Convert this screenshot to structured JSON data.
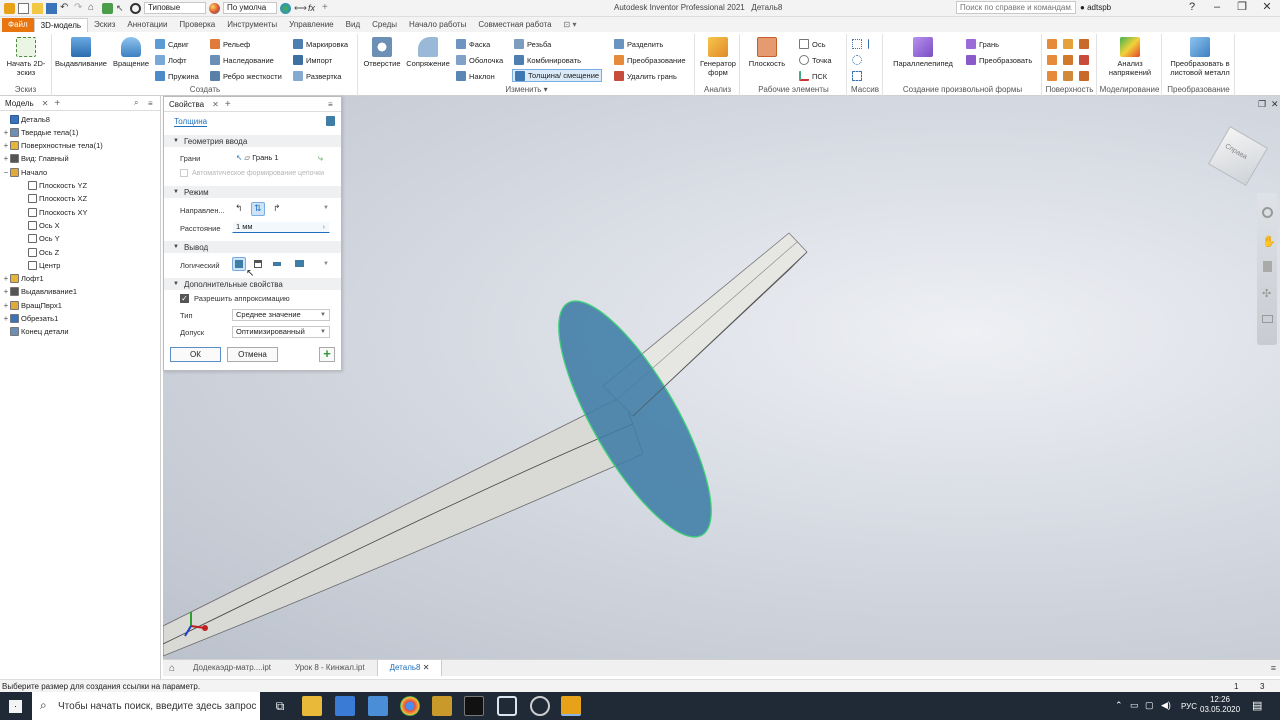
{
  "titlebar": {
    "app_title": "Autodesk Inventor Professional 2021",
    "doc_title": "Деталь8",
    "appearance_dropdown": "Типовые",
    "material_dropdown": "По умолча",
    "help_search_placeholder": "Поиск по справке и командам...",
    "user": "adtspb"
  },
  "tabs": [
    "Файл",
    "3D-модель",
    "Эскиз",
    "Аннотации",
    "Проверка",
    "Инструменты",
    "Управление",
    "Вид",
    "Среды",
    "Начало работы",
    "Совместная работа"
  ],
  "ribbon": {
    "sketch": {
      "start_sketch": "Начать 2D-эскиз",
      "label": "Эскиз"
    },
    "create": {
      "extrude": "Выдавливание",
      "revolve": "Вращение",
      "sweep": "Сдвиг",
      "loft": "Лофт",
      "coil": "Пружина",
      "emboss": "Рельеф",
      "derive": "Наследование",
      "rib": "Ребро жесткости",
      "decal": "Маркировка",
      "import": "Импорт",
      "unwrap": "Развертка",
      "label": "Создать"
    },
    "modify": {
      "hole": "Отверстие",
      "fillet": "Сопряжение",
      "chamfer": "Фаска",
      "shell": "Оболочка",
      "draft": "Наклон",
      "thread": "Резьба",
      "combine": "Комбинировать",
      "thicken": "Толщина/ смещение",
      "split": "Разделить",
      "direct": "Преобразование",
      "delete_face": "Удалить грань",
      "label": "Изменить"
    },
    "explore": {
      "generator": "Генератор форм",
      "label": "Анализ"
    },
    "work": {
      "plane": "Плоскость",
      "axis": "Ось",
      "point": "Точка",
      "ucs": "ПСК",
      "label": "Рабочие элементы"
    },
    "pattern": {
      "label": "Массив"
    },
    "freeform": {
      "box": "Параллелепипед",
      "face": "Грань",
      "convert": "Преобразовать",
      "label": "Создание произвольной формы"
    },
    "surface": {
      "label": "Поверхность"
    },
    "simulation": {
      "stress": "Анализ напряжений",
      "label": "Моделирование"
    },
    "convert": {
      "sheetmetal": "Преобразовать в листовой металл",
      "label": "Преобразование"
    }
  },
  "browser": {
    "tabs": [
      "Модель",
      "Свойства"
    ],
    "tree": [
      {
        "label": "Деталь8",
        "level": 0,
        "expander": ""
      },
      {
        "label": "Твердые тела(1)",
        "level": 1,
        "expander": "+"
      },
      {
        "label": "Поверхностные тела(1)",
        "level": 1,
        "expander": "+"
      },
      {
        "label": "Вид: Главный",
        "level": 1,
        "expander": "+"
      },
      {
        "label": "Начало",
        "level": 1,
        "expander": "−"
      },
      {
        "label": "Плоскость YZ",
        "level": 2,
        "expander": ""
      },
      {
        "label": "Плоскость XZ",
        "level": 2,
        "expander": ""
      },
      {
        "label": "Плоскость XY",
        "level": 2,
        "expander": ""
      },
      {
        "label": "Ось X",
        "level": 2,
        "expander": ""
      },
      {
        "label": "Ось Y",
        "level": 2,
        "expander": ""
      },
      {
        "label": "Ось Z",
        "level": 2,
        "expander": ""
      },
      {
        "label": "Центр",
        "level": 2,
        "expander": ""
      },
      {
        "label": "Лофт1",
        "level": 1,
        "expander": "+"
      },
      {
        "label": "Выдавливание1",
        "level": 1,
        "expander": "+"
      },
      {
        "label": "ВращПврх1",
        "level": 1,
        "expander": "+"
      },
      {
        "label": "Обрезать1",
        "level": 1,
        "expander": "+"
      },
      {
        "label": "Конец детали",
        "level": 1,
        "expander": ""
      }
    ]
  },
  "props": {
    "title": "Толщина",
    "input_geometry": {
      "header": "Геометрия ввода",
      "faces_label": "Грани",
      "faces_value": "Грань 1",
      "auto_chain": "Автоматическое формирование цепочки"
    },
    "mode": {
      "header": "Режим",
      "direction_label": "Направлен...",
      "distance_label": "Расстояние",
      "distance_value": "1 мм"
    },
    "output": {
      "header": "Вывод",
      "boolean_label": "Логический"
    },
    "advanced": {
      "header": "Дополнительные свойства",
      "allow_approx": "Разрешить аппроксимацию",
      "allow_approx_checked": true,
      "type_label": "Тип",
      "type_value": "Среднее значение",
      "tolerance_label": "Допуск",
      "tolerance_value": "Оптимизированный"
    },
    "ok": "ОК",
    "cancel": "Отмена"
  },
  "viewcube": {
    "face": "Справа"
  },
  "doc_tabs": [
    "Додекаэдр-матр....ipt",
    "Урок 8 - Кинжал.ipt",
    "Деталь8"
  ],
  "doc_tab_right": [
    "1",
    "3"
  ],
  "status": "Выберите размер для создания ссылки на параметр.",
  "taskbar": {
    "search_placeholder": "Чтобы начать поиск, введите здесь запрос",
    "lang": "РУС",
    "time": "12:26",
    "date": "03.05.2020"
  },
  "colors": {
    "accent": "#1e6fbf",
    "file_tab": "#e8750d",
    "surface": "#3f7ca6",
    "highlight": "#3fd17a"
  }
}
